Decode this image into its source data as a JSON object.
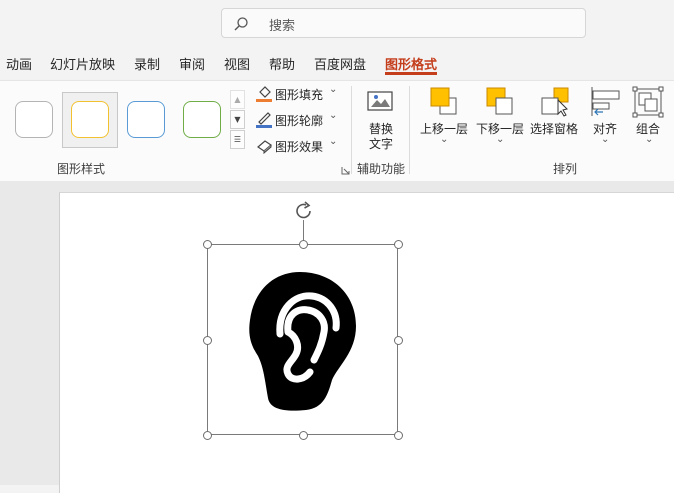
{
  "search": {
    "placeholder": "搜索",
    "icon": "search-icon"
  },
  "tabs": [
    {
      "label": "动画"
    },
    {
      "label": "幻灯片放映"
    },
    {
      "label": "录制"
    },
    {
      "label": "审阅"
    },
    {
      "label": "视图"
    },
    {
      "label": "帮助"
    },
    {
      "label": "百度网盘"
    },
    {
      "label": "图形格式",
      "active": true
    }
  ],
  "ribbon": {
    "shape_styles": {
      "group_label": "图形样式",
      "gallery_outline_colors": [
        "#b4b4b4",
        "#f2c230",
        "#5b9bd5",
        "#70ad47"
      ],
      "fill_label": "图形填充",
      "outline_label": "图形轮廓",
      "effects_label": "图形效果"
    },
    "accessibility": {
      "group_label": "辅助功能",
      "alt_text_line1": "替换",
      "alt_text_line2": "文字"
    },
    "arrange": {
      "group_label": "排列",
      "bring_forward_label": "上移一层",
      "send_backward_label": "下移一层",
      "selection_pane_label": "选择窗格",
      "align_label": "对齐",
      "group_obj_label": "组合"
    }
  },
  "colors": {
    "accent": "#c43e1c",
    "fill_swatch": "#ed7d31",
    "outline_swatch": "#4472c4",
    "arrange_icon": "#ffc000"
  },
  "slide": {
    "shape": "ear-icon"
  }
}
